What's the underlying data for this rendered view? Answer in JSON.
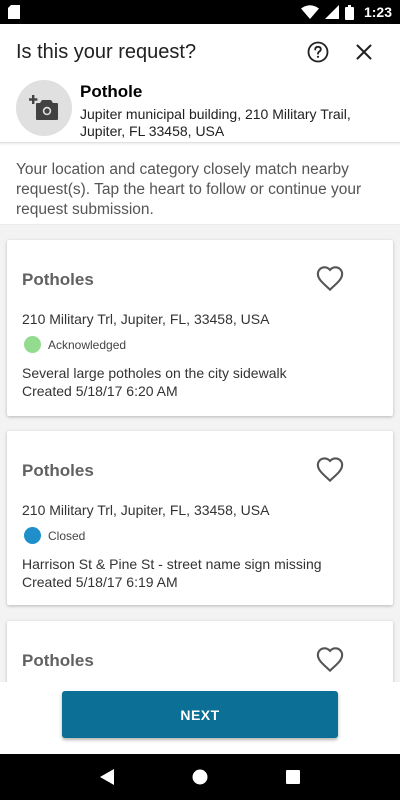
{
  "status_bar": {
    "time": "1:23"
  },
  "header": {
    "title": "Is this your request?",
    "help_icon": "help-circle-icon",
    "close_icon": "close-icon"
  },
  "request": {
    "category": "Pothole",
    "address": "Jupiter municipal building, 210 Military Trail, Jupiter, FL 33458, USA",
    "photo_icon": "add-photo-icon"
  },
  "intro_text": "Your location and category closely match nearby request(s). Tap the heart to follow or continue your request submission.",
  "cards": [
    {
      "title": "Potholes",
      "address": "210 Military Trl, Jupiter, FL, 33458, USA",
      "status": "Acknowledged",
      "status_color": "#93db8f",
      "description": "Several large potholes on the city sidewalk",
      "created": "Created 5/18/17 6:20 AM"
    },
    {
      "title": "Potholes",
      "address": "210 Military Trl, Jupiter, FL, 33458, USA",
      "status": "Closed",
      "status_color": "#1f8fc9",
      "description": "Harrison St & Pine St - street name sign missing",
      "created": "Created 5/18/17 6:19 AM"
    },
    {
      "title": "Potholes"
    }
  ],
  "footer": {
    "next_label": "NEXT"
  },
  "colors": {
    "accent": "#0b6f96",
    "acknowledged": "#93db8f",
    "closed": "#1f8fc9"
  }
}
